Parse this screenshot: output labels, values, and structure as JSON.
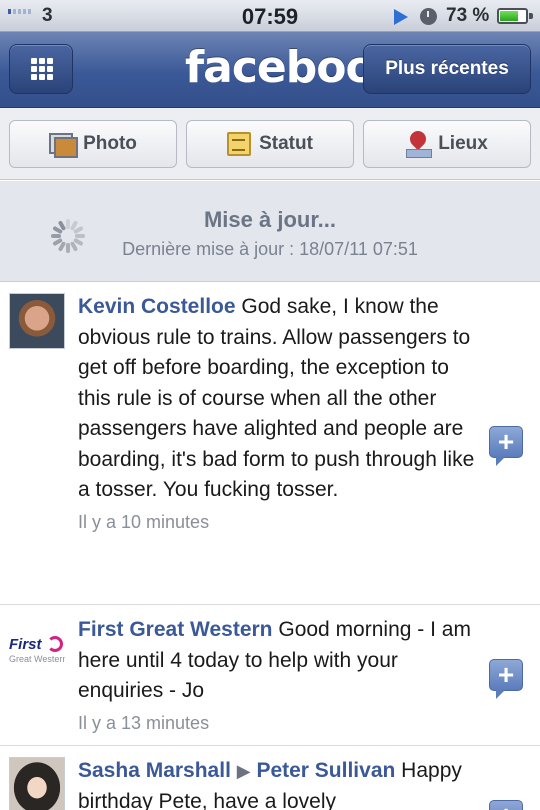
{
  "status_bar": {
    "carrier": "3",
    "time": "07:59",
    "battery_percent": "73 %",
    "battery_level": 0.73,
    "signal_bars": 1,
    "icons": [
      "signal-icon",
      "play-icon",
      "clock-icon",
      "battery-icon"
    ]
  },
  "nav": {
    "logo": "facebook",
    "recent_button": "Plus récentes",
    "menu_icon": "grid-icon"
  },
  "actions": {
    "photo": "Photo",
    "status": "Statut",
    "places": "Lieux"
  },
  "refresh": {
    "title": "Mise à jour...",
    "subtitle": "Dernière mise à jour : 18/07/11 07:51"
  },
  "posts": [
    {
      "author": "Kevin Costelloe",
      "text": "God sake, I know the obvious rule to trains. Allow passengers to get off before boarding, the exception to this rule is of course when all the other passengers have alighted and people are boarding, it's bad form to push through like a tosser. You fucking tosser.",
      "time": "Il y a 10 minutes"
    },
    {
      "author": "First Great Western",
      "text": "Good morning - I am here until 4 today to help with your enquiries - Jo",
      "time": "Il y a 13 minutes",
      "avatar_logo": "First",
      "avatar_sub": "Great Western"
    },
    {
      "author": "Sasha Marshall",
      "target": "Peter Sullivan",
      "text": "Happy birthday Pete, have a lovely"
    }
  ],
  "colors": {
    "facebook_blue": "#3b5998",
    "author_link": "#3b5998",
    "nav_bg": "#3b5998"
  }
}
